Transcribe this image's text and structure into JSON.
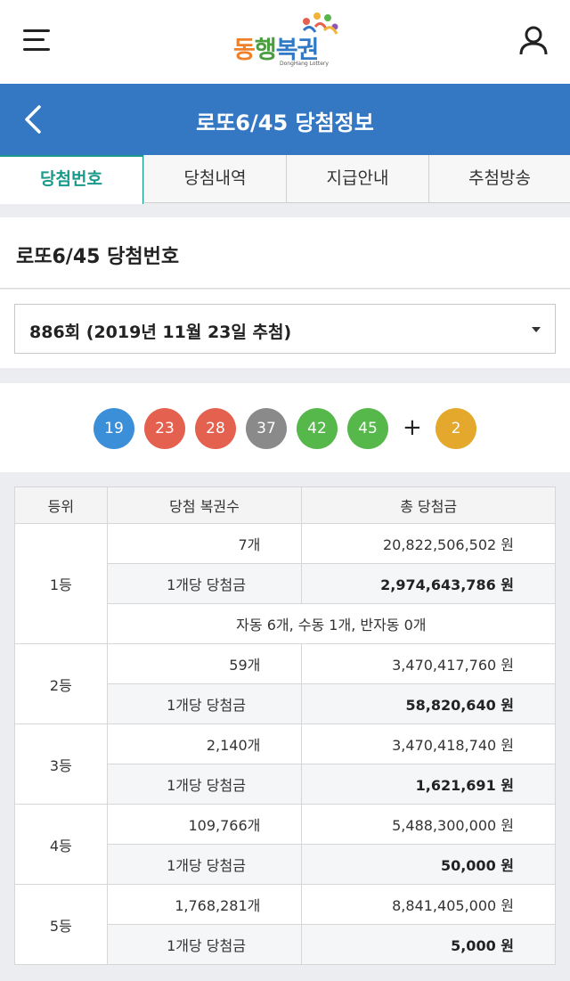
{
  "topbar": {
    "logo": {
      "word_1": "동",
      "word_2": "행",
      "word_3": "복권",
      "subtitle": "DongHang Lottery"
    }
  },
  "header": {
    "title": "로또6/45 당첨정보"
  },
  "tabs": [
    {
      "label": "당첨번호"
    },
    {
      "label": "당첨내역"
    },
    {
      "label": "지급안내"
    },
    {
      "label": "추첨방송"
    }
  ],
  "section": {
    "title": "로또6/45 당첨번호"
  },
  "draw_select": {
    "selected": "886회 (2019년 11월 23일 추첨)"
  },
  "numbers": {
    "main": [
      "19",
      "23",
      "28",
      "37",
      "42",
      "45"
    ],
    "plus": "+",
    "bonus": "2",
    "colors": [
      "#3b8fd8",
      "#e4604f",
      "#e4604f",
      "#8a8a8a",
      "#56b74b",
      "#56b74b"
    ],
    "bonus_color": "#e3a82c"
  },
  "table": {
    "headers": [
      "등위",
      "당첨 복권수",
      "총 당첨금"
    ],
    "per_label": "1개당 당첨금",
    "rows": [
      {
        "rank": "1등",
        "count": "7개",
        "total": "20,822,506,502 원",
        "per": "2,974,643,786 원",
        "note": "자동 6개, 수동 1개, 반자동 0개"
      },
      {
        "rank": "2등",
        "count": "59개",
        "total": "3,470,417,760 원",
        "per": "58,820,640 원"
      },
      {
        "rank": "3등",
        "count": "2,140개",
        "total": "3,470,418,740 원",
        "per": "1,621,691 원"
      },
      {
        "rank": "4등",
        "count": "109,766개",
        "total": "5,488,300,000 원",
        "per": "50,000 원"
      },
      {
        "rank": "5등",
        "count": "1,768,281개",
        "total": "8,841,405,000 원",
        "per": "5,000 원"
      }
    ]
  }
}
